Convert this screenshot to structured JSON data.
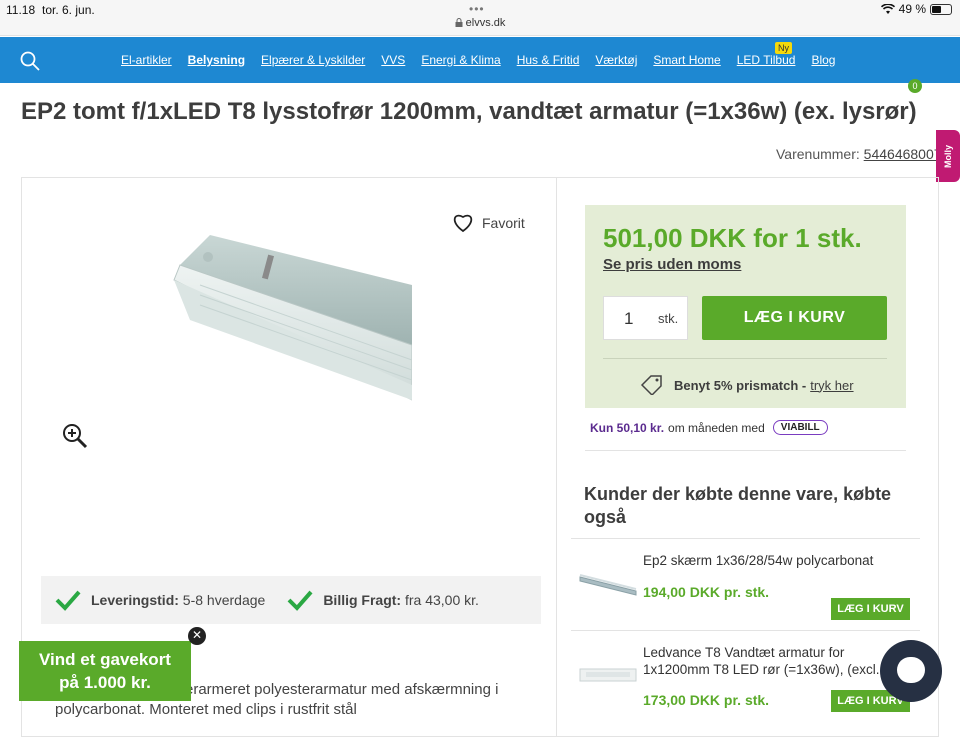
{
  "status_bar": {
    "time": "11.18",
    "date": "tor. 6. jun.",
    "dots": "•••",
    "battery": "49 %",
    "url": "elvvs.dk"
  },
  "nav": {
    "links": [
      "El-artikler",
      "Belysning",
      "Elpærer & Lyskilder",
      "VVS",
      "Energi & Klima",
      "Hus & Fritid",
      "Værktøj",
      "Smart Home",
      "LED Tilbud",
      "Blog"
    ],
    "badge_new": "Ny",
    "cart_count": "0",
    "colors": {
      "nav_bg": "#1e88d2",
      "accent_green": "#5aaa2a"
    }
  },
  "product": {
    "title": "EP2 tomt f/1xLED T8 lysstofrør 1200mm, vandtæt armatur (=1x36w) (ex. lysrør)",
    "varenummer_label": "Varenummer:",
    "varenummer": "5446468007",
    "favorite_label": "Favorit",
    "price": "501,00 DKK for 1 stk.",
    "price_ex_vat_link": "Se pris uden moms",
    "qty": "1",
    "qty_unit": "stk.",
    "add_to_cart": "LÆG I KURV",
    "prismatch_text": "Benyt 5% prismatch -",
    "prismatch_link": "tryk her",
    "viabill_prefix": "Kun 50,10 kr.",
    "viabill_text": "om måneden med",
    "viabill_brand": "VIABILL",
    "delivery_label": "Leveringstid:",
    "delivery_value": "5-8 hverdage",
    "freight_label": "Billig Fragt:",
    "freight_value": "fra 43,00 kr.",
    "description_line1": "erarmeret polyesterarmatur med afskærmning i",
    "description_line2": "polycarbonat. Monteret med clips i rustfrit stål"
  },
  "gift_card": {
    "text_line1": "Vind et gavekort",
    "text_line2": "på 1.000 kr.",
    "close": "✕"
  },
  "side_tab": {
    "label": "Molly"
  },
  "related": {
    "title": "Kunder der købte denne vare, købte også",
    "items": [
      {
        "name": "Ep2 skærm 1x36/28/54w polycarbonat",
        "price": "194,00 DKK pr. stk.",
        "button": "LÆG I KURV"
      },
      {
        "name": "Ledvance T8 Vandtæt armatur for 1x1200mm T8 LED rør (=1x36w), (excl.",
        "price": "173,00 DKK pr. stk.",
        "button": "LÆG I KURV"
      }
    ]
  }
}
